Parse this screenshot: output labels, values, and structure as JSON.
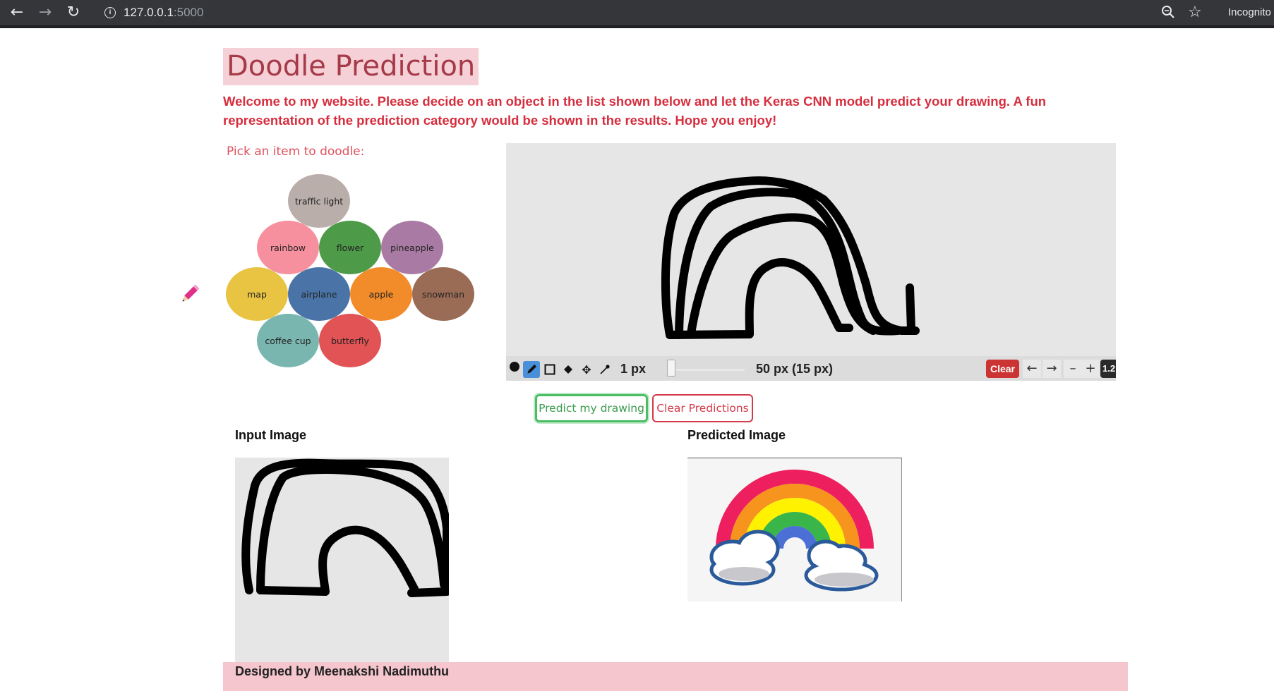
{
  "browser": {
    "url_host": "127.0.0.1",
    "url_port": ":5000",
    "incognito_label": "Incognito"
  },
  "page": {
    "title": "Doodle Prediction",
    "welcome": "Welcome to my website. Please decide on an object in the list shown below and let the Keras CNN model predict your drawing. A fun representation of the prediction category would be shown in the results. Hope you enjoy!",
    "pick_label": "Pick an item to doodle:"
  },
  "items": [
    {
      "label": "traffic light",
      "color": "#b9aeaa"
    },
    {
      "label": "rainbow",
      "color": "#f7909e"
    },
    {
      "label": "flower",
      "color": "#4d9a48"
    },
    {
      "label": "pineapple",
      "color": "#a97ba4"
    },
    {
      "label": "map",
      "color": "#e9c443"
    },
    {
      "label": "airplane",
      "color": "#4a74a8"
    },
    {
      "label": "apple",
      "color": "#f28c2a"
    },
    {
      "label": "snowman",
      "color": "#9b6c55"
    },
    {
      "label": "coffee cup",
      "color": "#79b6b0"
    },
    {
      "label": "butterfly",
      "color": "#e15355"
    }
  ],
  "canvas_toolbar": {
    "pen_size": "1 px",
    "size_readout": "50 px (15 px)",
    "clear_label": "Clear",
    "undo_label": "←",
    "redo_label": "→",
    "zoom_out_label": "–",
    "zoom_in_label": "+",
    "zoom_level": "1.2"
  },
  "buttons": {
    "predict": "Predict my drawing",
    "clear_predictions": "Clear Predictions"
  },
  "results": {
    "input_label": "Input Image",
    "predicted_label": "Predicted Image"
  },
  "footer": {
    "text": "Designed by Meenakshi Nadimuthu"
  }
}
